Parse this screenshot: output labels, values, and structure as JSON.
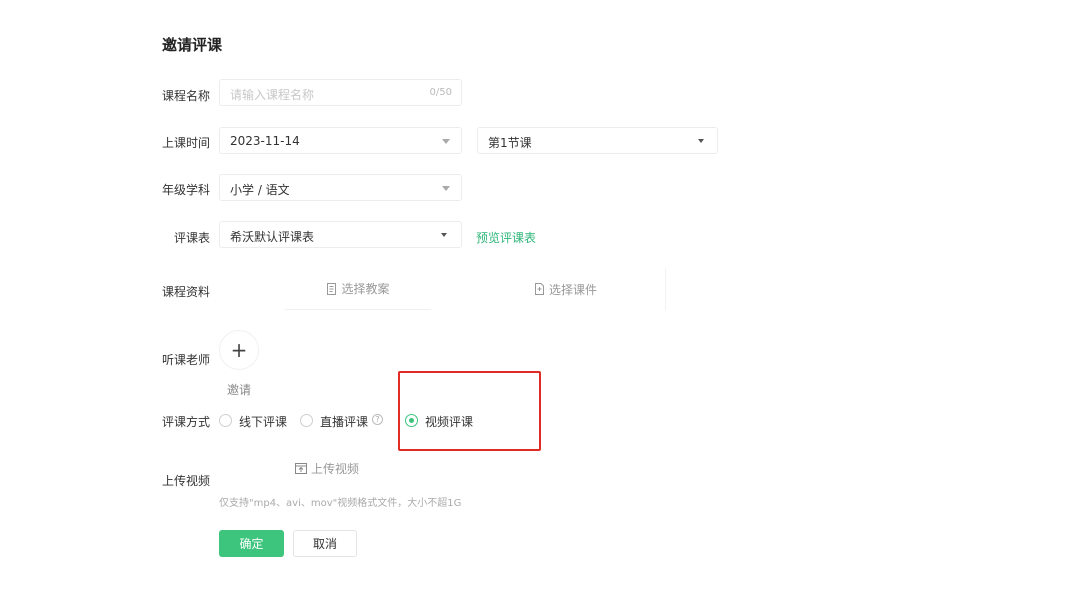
{
  "page": {
    "title": "邀请评课"
  },
  "form": {
    "course_name": {
      "label": "课程名称",
      "placeholder": "请输入课程名称",
      "counter": "0/50"
    },
    "class_time": {
      "label": "上课时间",
      "date": "2023-11-14",
      "period": "第1节课"
    },
    "grade_subject": {
      "label": "年级学科",
      "value": "小学 / 语文"
    },
    "evaluation_form": {
      "label": "评课表",
      "value": "希沃默认评课表",
      "preview_link": "预览评课表"
    },
    "course_materials": {
      "label": "课程资料",
      "select_lesson_plan": "选择教案",
      "select_courseware": "选择课件"
    },
    "teachers": {
      "label": "听课老师",
      "add_symbol": "+",
      "invite": "邀请"
    },
    "method": {
      "label": "评课方式",
      "options": [
        {
          "label": "线下评课",
          "selected": false
        },
        {
          "label": "直播评课",
          "selected": false,
          "help": "?"
        },
        {
          "label": "视频评课",
          "selected": true
        }
      ]
    },
    "upload": {
      "label": "上传视频",
      "button": "上传视频",
      "hint": "仅支持\"mp4、avi、mov\"视频格式文件，大小不超1G"
    }
  },
  "actions": {
    "confirm": "确定",
    "cancel": "取消"
  },
  "colors": {
    "accent": "#3dc47d",
    "link": "#2fb67a",
    "highlight": "#e02c24"
  }
}
